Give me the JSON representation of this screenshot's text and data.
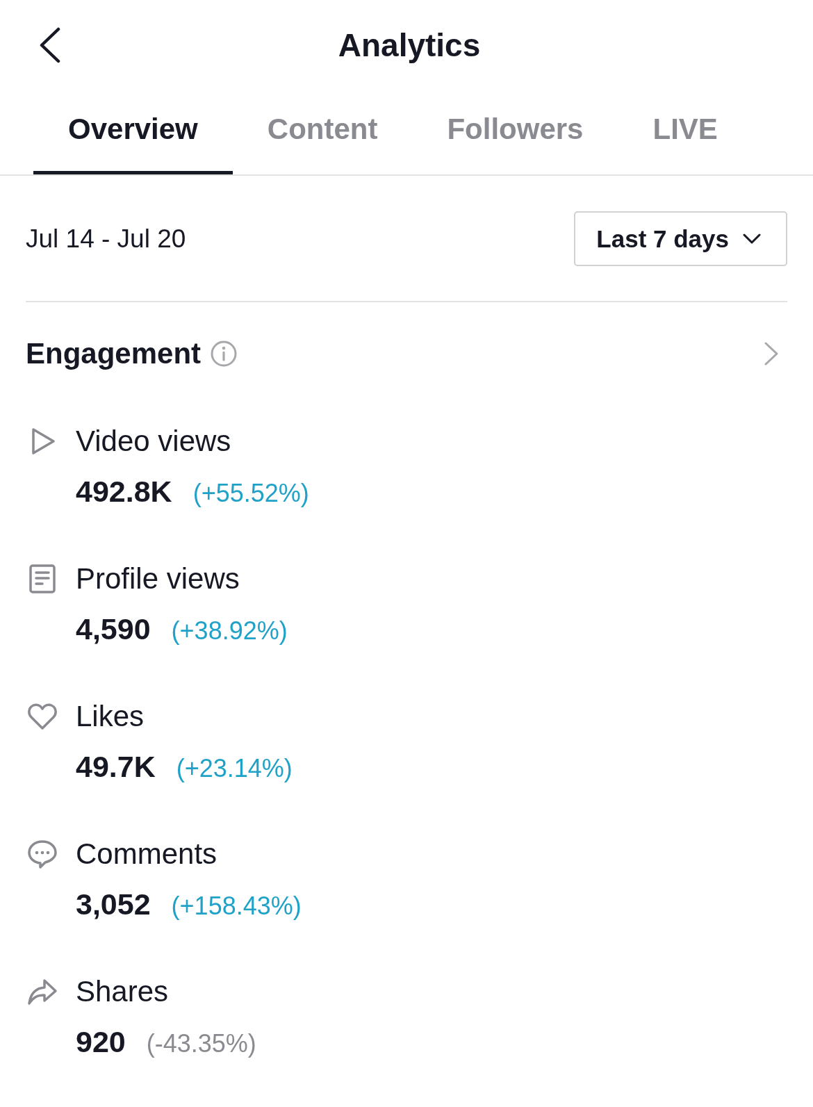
{
  "header": {
    "title": "Analytics"
  },
  "tabs": [
    {
      "label": "Overview",
      "selected": true
    },
    {
      "label": "Content",
      "selected": false
    },
    {
      "label": "Followers",
      "selected": false
    },
    {
      "label": "LIVE",
      "selected": false
    }
  ],
  "date_range": {
    "label": "Jul 14 - Jul 20",
    "period": "Last 7 days"
  },
  "engagement": {
    "title": "Engagement",
    "metrics": [
      {
        "label": "Video views",
        "value": "492.8K",
        "change": "(+55.52%)",
        "positive": true
      },
      {
        "label": "Profile views",
        "value": "4,590",
        "change": "(+38.92%)",
        "positive": true
      },
      {
        "label": "Likes",
        "value": "49.7K",
        "change": "(+23.14%)",
        "positive": true
      },
      {
        "label": "Comments",
        "value": "3,052",
        "change": "(+158.43%)",
        "positive": true
      },
      {
        "label": "Shares",
        "value": "920",
        "change": "(-43.35%)",
        "positive": false
      }
    ]
  }
}
